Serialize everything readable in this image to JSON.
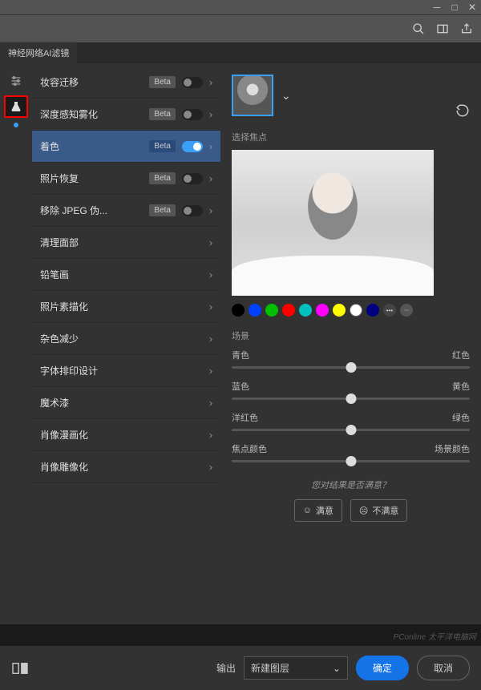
{
  "tab_title": "神经网络AI滤镜",
  "filters": [
    {
      "name": "妆容迁移",
      "beta": true,
      "on": false
    },
    {
      "name": "深度感知雾化",
      "beta": true,
      "on": false
    },
    {
      "name": "着色",
      "beta": true,
      "on": true,
      "selected": true
    },
    {
      "name": "照片恢复",
      "beta": true,
      "on": false
    },
    {
      "name": "移除 JPEG 伪...",
      "beta": true,
      "on": false
    },
    {
      "name": "清理面部",
      "beta": false,
      "on": false
    },
    {
      "name": "铅笔画",
      "beta": false,
      "on": false
    },
    {
      "name": "照片素描化",
      "beta": false,
      "on": false
    },
    {
      "name": "杂色减少",
      "beta": false,
      "on": false
    },
    {
      "name": "字体排印设计",
      "beta": false,
      "on": false
    },
    {
      "name": "魔术漆",
      "beta": false,
      "on": false
    },
    {
      "name": "肖像漫画化",
      "beta": false,
      "on": false
    },
    {
      "name": "肖像雕像化",
      "beta": false,
      "on": false
    }
  ],
  "beta_label": "Beta",
  "focus_label": "选择焦点",
  "swatch_colors": [
    "#000000",
    "#0040ff",
    "#00c000",
    "#ff0000",
    "#00c0c0",
    "#ff00ff",
    "#ffff00",
    "#ffffff",
    "#000080"
  ],
  "scene_label": "场景",
  "sliders": [
    {
      "left": "青色",
      "right": "红色",
      "pos": 50
    },
    {
      "left": "蓝色",
      "right": "黄色",
      "pos": 50
    },
    {
      "left": "洋红色",
      "right": "绿色",
      "pos": 50
    },
    {
      "left": "焦点颜色",
      "right": "场景颜色",
      "pos": 50
    }
  ],
  "feedback_q": "您对结果是否满意？",
  "feedback_yes": "满意",
  "feedback_no": "不满意",
  "output_label": "输出",
  "output_value": "新建图层",
  "ok_label": "确定",
  "cancel_label": "取消",
  "watermark": "PConline 太平洋电脑网"
}
